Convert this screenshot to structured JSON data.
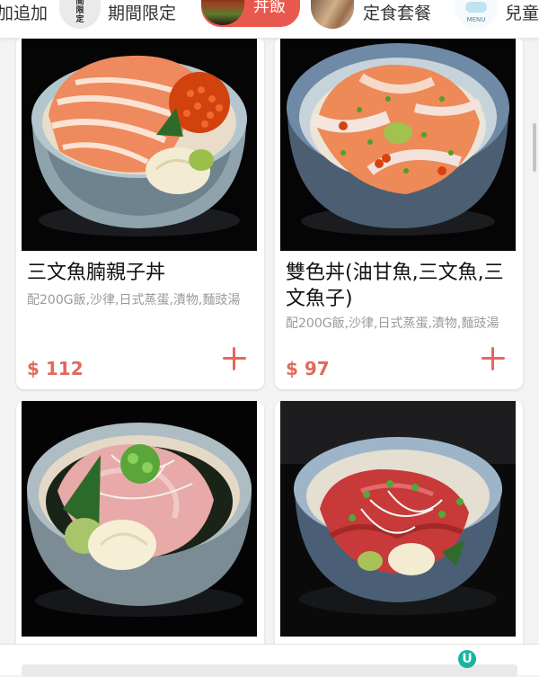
{
  "tabs": [
    {
      "id": "add",
      "label": "加追加",
      "selected": false
    },
    {
      "id": "limited",
      "label": "期間限定",
      "thumb_text": "期間限定",
      "selected": false
    },
    {
      "id": "don",
      "label": "丼飯",
      "selected": true
    },
    {
      "id": "set",
      "label": "定食套餐",
      "selected": false
    },
    {
      "id": "kids",
      "label": "兒童",
      "thumb_text": "MENU",
      "selected": false
    }
  ],
  "products": [
    {
      "name": "三文魚腩親子丼",
      "description": "配200G飯,沙律,日式蒸蛋,漬物,麵豉湯",
      "price": "$ 112",
      "photo": "salmon-belly-ikura-bowl"
    },
    {
      "name": "雙色丼(油甘魚,三文魚,三文魚子)",
      "description": "配200G飯,沙律,日式蒸蛋,漬物,麵豉湯",
      "price": "$ 97",
      "photo": "yellowtail-salmon-ikura-bowl"
    },
    {
      "name": "",
      "description": "",
      "price": "",
      "photo": "negitoro-bowl"
    },
    {
      "name": "",
      "description": "",
      "price": "",
      "photo": "tuna-bowl"
    }
  ],
  "badge": {
    "letter": "U"
  },
  "colors": {
    "accent": "#e8584e",
    "price": "#e06a5c",
    "desc": "#9a9a9a",
    "badge": "#19b4a0"
  },
  "icons": [
    "add-icon",
    "scroll-indicator",
    "u-badge-icon"
  ]
}
